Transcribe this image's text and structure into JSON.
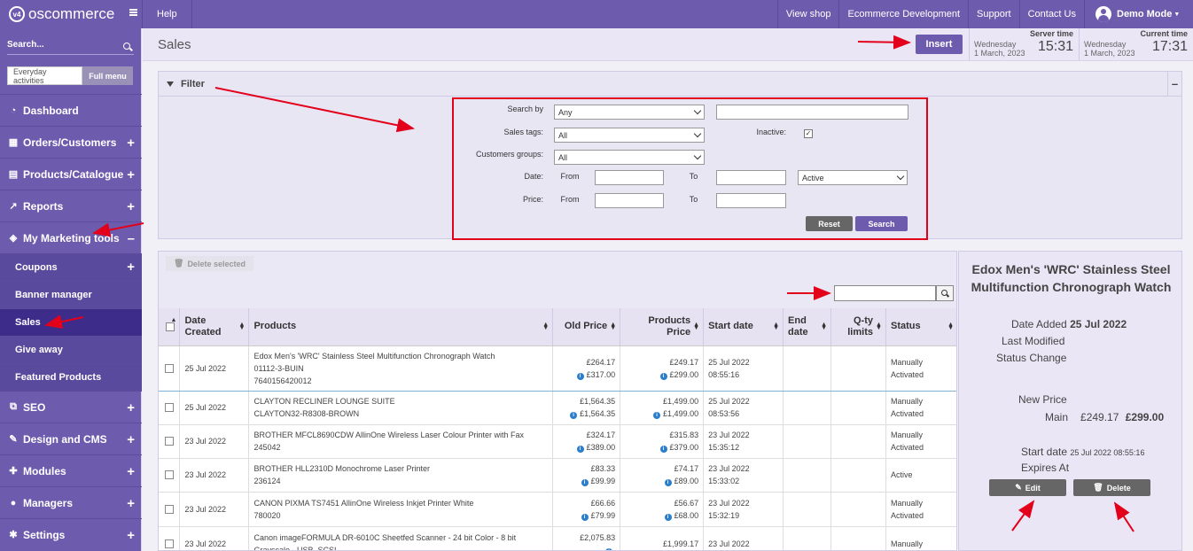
{
  "topbar": {
    "logo_text": "oscommerce",
    "logo_mark": "v4",
    "help": "Help",
    "links": [
      "View shop",
      "Ecommerce Development",
      "Support",
      "Contact Us"
    ],
    "user": "Demo Mode"
  },
  "sidebar": {
    "search_placeholder": "Search...",
    "tab_everyday": "Everyday activities",
    "tab_full": "Full menu",
    "items": {
      "dashboard": "Dashboard",
      "orders": "Orders/Customers",
      "products": "Products/Catalogue",
      "reports": "Reports",
      "marketing": "My Marketing tools",
      "coupons": "Coupons",
      "banner": "Banner manager",
      "sales": "Sales",
      "giveaway": "Give away",
      "featured": "Featured Products",
      "seo": "SEO",
      "design": "Design and CMS",
      "modules": "Modules",
      "managers": "Managers",
      "settings": "Settings"
    }
  },
  "header": {
    "title": "Sales",
    "insert": "Insert",
    "server_time_label": "Server time",
    "server_day": "Wednesday",
    "server_date": "1 March, 2023",
    "server_time": "15:31",
    "current_time_label": "Current time",
    "current_day": "Wednesday",
    "current_date": "1 March, 2023",
    "current_time": "17:31"
  },
  "filter": {
    "title": "Filter",
    "collapse": "–",
    "search_by_label": "Search by",
    "search_by_value": "Any",
    "sales_tags_label": "Sales tags:",
    "sales_tags_value": "All",
    "inactive_label": "Inactive:",
    "customers_groups_label": "Customers groups:",
    "customers_groups_value": "All",
    "date_label": "Date:",
    "from_label": "From",
    "to_label": "To",
    "status_value": "Active",
    "price_label": "Price:",
    "reset": "Reset",
    "search": "Search"
  },
  "table": {
    "delete_selected": "Delete selected",
    "columns": {
      "date_created": [
        "Date",
        "Created"
      ],
      "products": "Products",
      "old_price": "Old Price",
      "products_price": [
        "Products",
        "Price"
      ],
      "start_date": "Start date",
      "end_date": [
        "End",
        "date"
      ],
      "qty_limits": [
        "Q-ty",
        "limits"
      ],
      "status": "Status"
    },
    "rows": [
      {
        "date": "25 Jul 2022",
        "product": [
          "Edox Men's 'WRC' Stainless Steel Multifunction Chronograph Watch",
          "01112-3-BUIN",
          "7640156420012"
        ],
        "old1": "£264.17",
        "old2": "£317.00",
        "new1": "£249.17",
        "new2": "£299.00",
        "start1": "25 Jul 2022",
        "start2": "08:55:16",
        "status": [
          "Manually",
          "Activated"
        ]
      },
      {
        "date": "25 Jul 2022",
        "product": [
          "CLAYTON RECLINER LOUNGE SUITE",
          "CLAYTON32-R8308-BROWN"
        ],
        "old1": "£1,564.35",
        "old2": "£1,564.35",
        "new1": "£1,499.00",
        "new2": "£1,499.00",
        "start1": "25 Jul 2022",
        "start2": "08:53:56",
        "status": [
          "Manually",
          "Activated"
        ]
      },
      {
        "date": "23 Jul 2022",
        "product": [
          "BROTHER MFCL8690CDW AllinOne Wireless Laser Colour Printer with Fax",
          "245042"
        ],
        "old1": "£324.17",
        "old2": "£389.00",
        "new1": "£315.83",
        "new2": "£379.00",
        "start1": "23 Jul 2022",
        "start2": "15:35:12",
        "status": [
          "Manually",
          "Activated"
        ]
      },
      {
        "date": "23 Jul 2022",
        "product": [
          "BROTHER HLL2310D Monochrome Laser Printer",
          "236124"
        ],
        "old1": "£83.33",
        "old2": "£99.99",
        "new1": "£74.17",
        "new2": "£89.00",
        "start1": "23 Jul 2022",
        "start2": "15:33:02",
        "status": [
          "Active"
        ]
      },
      {
        "date": "23 Jul 2022",
        "product": [
          "CANON PIXMA TS7451 AllinOne Wireless Inkjet Printer White",
          "780020"
        ],
        "old1": "£66.66",
        "old2": "£79.99",
        "new1": "£56.67",
        "new2": "£68.00",
        "start1": "23 Jul 2022",
        "start2": "15:32:19",
        "status": [
          "Manually",
          "Activated"
        ]
      },
      {
        "date": "23 Jul 2022",
        "product": [
          "Canon imageFORMULA DR-6010C Sheetfed Scanner - 24 bit Color - 8 bit",
          "Grayscale - USB, SCSI"
        ],
        "old1": "£2,075.83",
        "old2": "",
        "new1": "£1,999.17",
        "new2": "",
        "start1": "23 Jul 2022",
        "start2": "",
        "status": [
          "Manually"
        ]
      }
    ]
  },
  "details": {
    "title": "Edox Men's 'WRC' Stainless Steel Multifunction Chronograph Watch",
    "date_added_label": "Date Added",
    "date_added": "25 Jul 2022",
    "last_modified_label": "Last Modified",
    "status_change_label": "Status Change",
    "new_price_label": "New Price",
    "main_label": "Main",
    "main_price1": "£249.17",
    "main_price2": "£299.00",
    "start_date_label": "Start date",
    "start_date": "25 Jul 2022 08:55:16",
    "expires_label": "Expires At",
    "edit": "Edit",
    "delete": "Delete"
  },
  "colors": {
    "brand": "#6d5cae",
    "annotation": "#e3001b",
    "info": "#2a7ecb"
  }
}
